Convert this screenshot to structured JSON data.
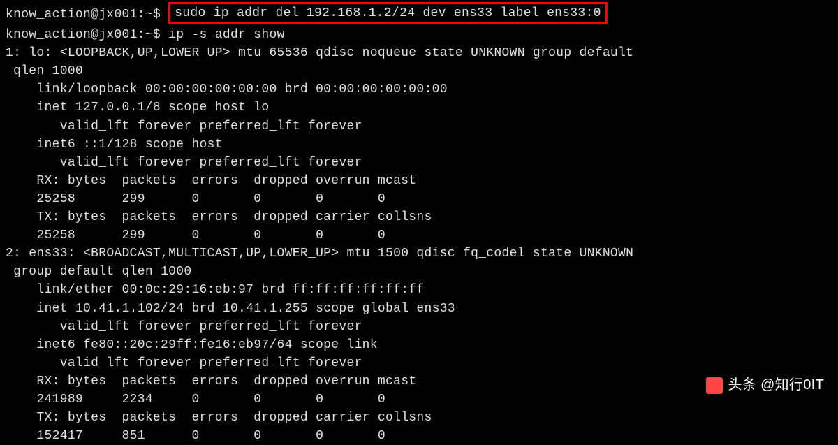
{
  "prompt1_user": "know_action",
  "prompt1_host": "jx001",
  "prompt1_path": "~",
  "prompt1_symbol": "$",
  "cmd1": "sudo ip addr del 192.168.1.2/24 dev ens33 label ens33:0",
  "prompt2_full": "know_action@jx001:~$ ip -s addr show",
  "output": {
    "l1": "1: lo: <LOOPBACK,UP,LOWER_UP> mtu 65536 qdisc noqueue state UNKNOWN group default",
    "l2": " qlen 1000",
    "l3": "    link/loopback 00:00:00:00:00:00 brd 00:00:00:00:00:00",
    "l4": "    inet 127.0.0.1/8 scope host lo",
    "l5": "       valid_lft forever preferred_lft forever",
    "l6": "    inet6 ::1/128 scope host",
    "l7": "       valid_lft forever preferred_lft forever",
    "l8": "    RX: bytes  packets  errors  dropped overrun mcast",
    "l9": "    25258      299      0       0       0       0",
    "l10": "    TX: bytes  packets  errors  dropped carrier collsns",
    "l11": "    25258      299      0       0       0       0",
    "l12": "2: ens33: <BROADCAST,MULTICAST,UP,LOWER_UP> mtu 1500 qdisc fq_codel state UNKNOWN",
    "l13": " group default qlen 1000",
    "l14": "    link/ether 00:0c:29:16:eb:97 brd ff:ff:ff:ff:ff:ff",
    "l15": "    inet 10.41.1.102/24 brd 10.41.1.255 scope global ens33",
    "l16": "       valid_lft forever preferred_lft forever",
    "l17": "    inet6 fe80::20c:29ff:fe16:eb97/64 scope link",
    "l18": "       valid_lft forever preferred_lft forever",
    "l19": "    RX: bytes  packets  errors  dropped overrun mcast",
    "l20": "    241989     2234     0       0       0       0",
    "l21": "    TX: bytes  packets  errors  dropped carrier collsns",
    "l22": "    152417     851      0       0       0       0"
  },
  "watermark": "头条 @知行0IT"
}
